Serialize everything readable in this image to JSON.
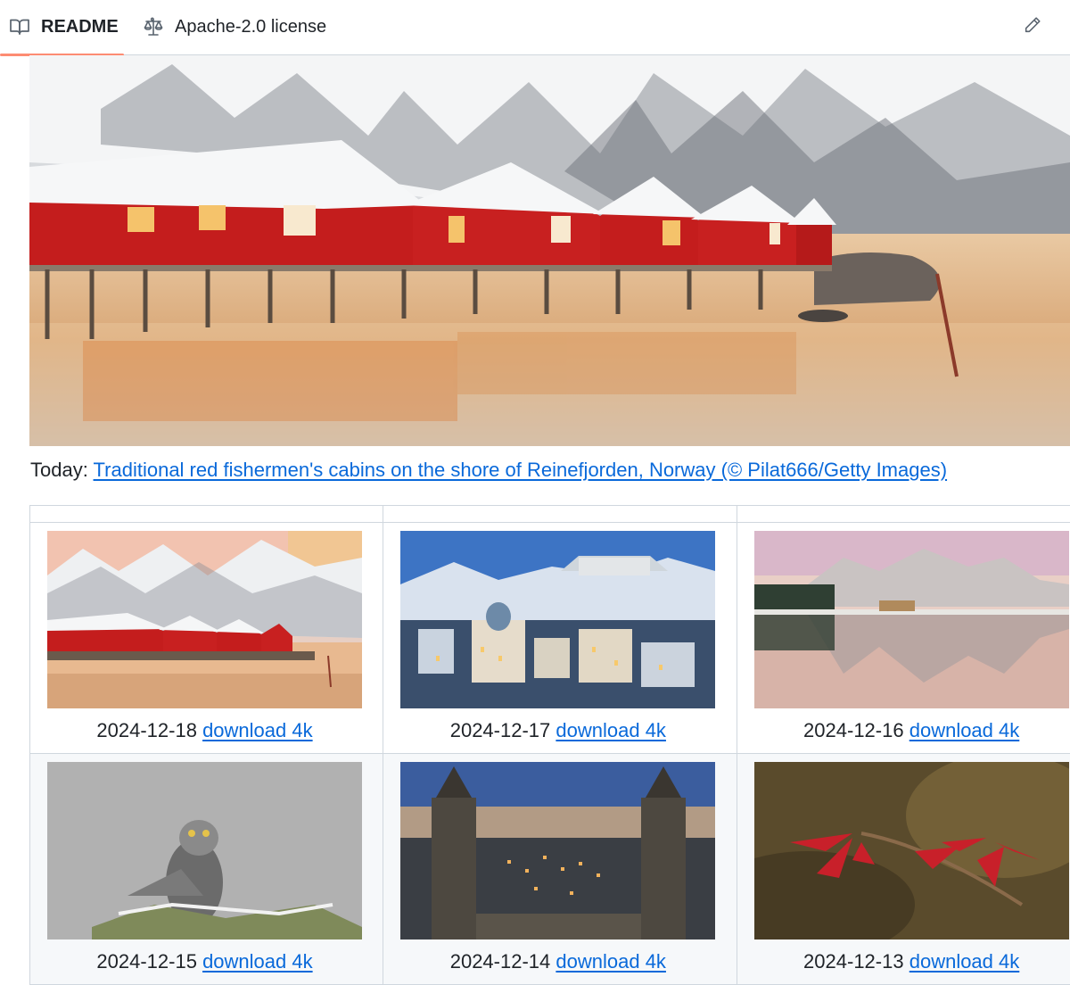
{
  "tabs": {
    "readme": "README",
    "license": "Apache-2.0 license"
  },
  "hero": {
    "alt": "Traditional red fishermen's cabins on the shore of Reinefjorden, Norway"
  },
  "caption": {
    "prefix": "Today: ",
    "link_text": "Traditional red fishermen's cabins on the shore of Reinefjorden, Norway (© Pilat666/Getty Images)"
  },
  "gallery": [
    {
      "date": "2024-12-18",
      "link_text": "download 4k"
    },
    {
      "date": "2024-12-17",
      "link_text": "download 4k"
    },
    {
      "date": "2024-12-16",
      "link_text": "download 4k"
    },
    {
      "date": "2024-12-15",
      "link_text": "download 4k"
    },
    {
      "date": "2024-12-14",
      "link_text": "download 4k"
    },
    {
      "date": "2024-12-13",
      "link_text": "download 4k"
    }
  ],
  "colors": {
    "link": "#0969da",
    "tab_underline": "#fd8c73",
    "border": "#d0d7de"
  },
  "icons": {
    "readme": "book-icon",
    "license": "law-scale-icon",
    "edit": "pencil-icon"
  }
}
